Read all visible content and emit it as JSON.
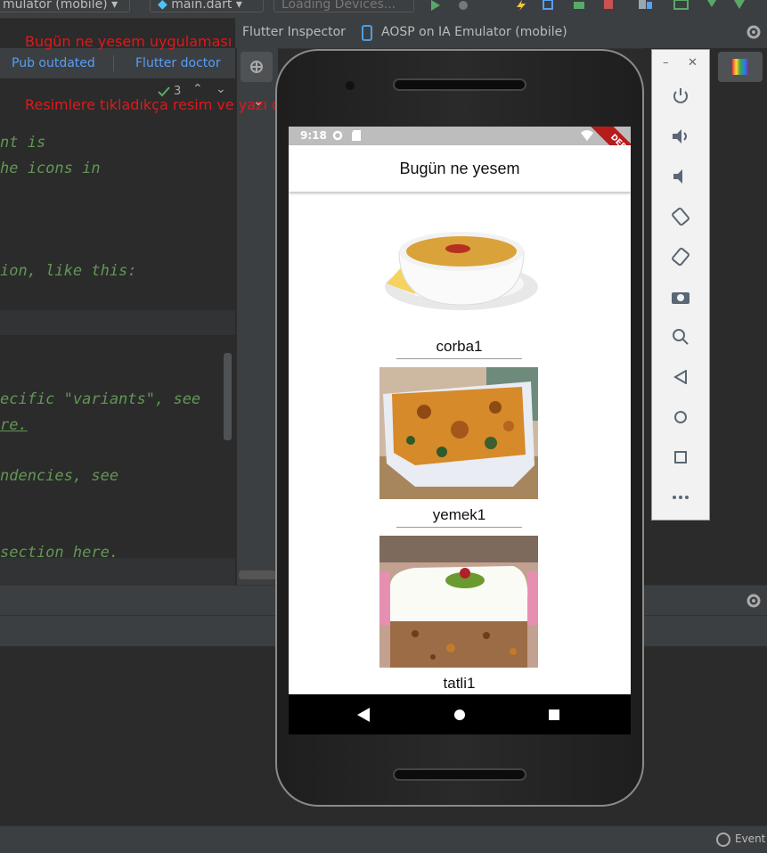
{
  "toolbar": {
    "device_select": "mulator (mobile)",
    "file_select": "main.dart",
    "devices_select": "Loading Devices..."
  },
  "tabs": {
    "inspector": "Flutter Inspector",
    "emulator": "AOSP on IA Emulator (mobile)"
  },
  "pub": {
    "outdated": "Pub outdated",
    "doctor": "Flutter doctor",
    "check_count": "3"
  },
  "annotations": {
    "title": "Bugün ne yesem uygulaması",
    "subtitle": "Resimlere tıkladıkça resim ve yazı değişiyor"
  },
  "code_lines": {
    "l1": "nt is",
    "l2": "he icons in",
    "l3": "ion, like this:",
    "l4": "ecific \"variants\", see",
    "l5": "re.",
    "l6": "ndencies, see",
    "l7": "section here."
  },
  "phone": {
    "time": "9:18",
    "debug_banner": "DEBUG",
    "app_title": "Bugün ne yesem",
    "foods": [
      {
        "label": "corba1"
      },
      {
        "label": "yemek1"
      },
      {
        "label": "tatli1"
      }
    ]
  },
  "status_bar": {
    "event": "Event"
  },
  "colors": {
    "annotation": "#e0181a",
    "link": "#589df6",
    "code_comment": "#629755",
    "ide_bg": "#2b2b2b"
  }
}
